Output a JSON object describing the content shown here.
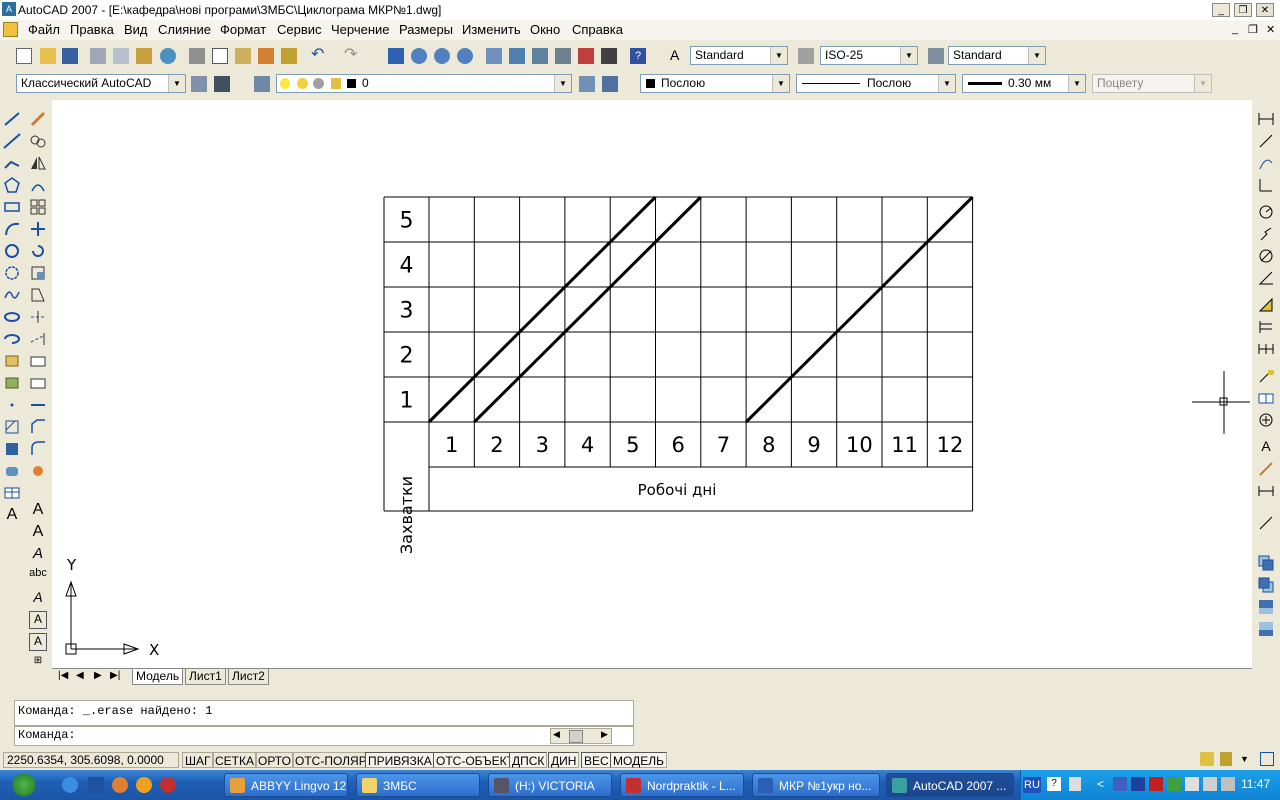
{
  "window": {
    "title": "AutoCAD 2007 - [E:\\кафедра\\нові програми\\ЗМБС\\Циклограма МКР№1.dwg]"
  },
  "menu": [
    "Файл",
    "Правка",
    "Вид",
    "Слияние",
    "Формат",
    "Сервис",
    "Черчение",
    "Размеры",
    "Изменить",
    "Окно",
    "Справка"
  ],
  "toolbar_styles": {
    "text_style": "Standard",
    "dim_style": "ISO-25",
    "table_style": "Standard"
  },
  "toolbar_layers": {
    "workspace": "Классический AutoCAD",
    "layer": "0",
    "color": "Послою",
    "linetype": "Послою",
    "lineweight": "0.30 мм",
    "plotstyle": "Поцвету"
  },
  "drawing": {
    "row_labels": [
      "5",
      "4",
      "3",
      "2",
      "1"
    ],
    "vertical_label": "Захватки",
    "column_labels": [
      "1",
      "2",
      "3",
      "4",
      "5",
      "6",
      "7",
      "8",
      "9",
      "10",
      "11",
      "12"
    ],
    "bottom_label": "Робочі дні",
    "ucs_x": "X",
    "ucs_y": "Y"
  },
  "tabs": [
    "Модель",
    "Лист1",
    "Лист2"
  ],
  "command": {
    "history": "Команда: _.erase найдено: 1",
    "prompt": "Команда:"
  },
  "status": {
    "coords": "2250.6354, 305.6098, 0.0000",
    "buttons": [
      "ШАГ",
      "СЕТКА",
      "ОРТО",
      "ОТС-ПОЛЯР",
      "ПРИВЯЗКА",
      "ОТС-ОБЪЕКТ",
      "ДПСК",
      "ДИН",
      "ВЕС",
      "МОДЕЛЬ"
    ],
    "active": [
      "ПРИВЯЗКА",
      "ОТС-ОБЪЕКТ",
      "ДПСК",
      "ДИН",
      "ВЕС",
      "МОДЕЛЬ"
    ]
  },
  "taskbar": {
    "items": [
      {
        "label": "ABBYY Lingvo 12",
        "icon_color": "#e8a13a"
      },
      {
        "label": "ЗМБС",
        "icon_color": "#f2d36b"
      },
      {
        "label": "(H:) VICTORIA",
        "icon_color": "#556"
      },
      {
        "label": "Nordpraktik - L...",
        "icon_color": "#c03030"
      },
      {
        "label": "МКР №1укр но...",
        "icon_color": "#2b5fb4"
      },
      {
        "label": "AutoCAD 2007 ...",
        "icon_color": "#3aa0a0"
      }
    ],
    "lang": "RU",
    "clock": "11:47"
  },
  "colors": {
    "accent": "#1e5fb5",
    "canvas": "#ffffff",
    "chrome": "#ece9d8"
  }
}
